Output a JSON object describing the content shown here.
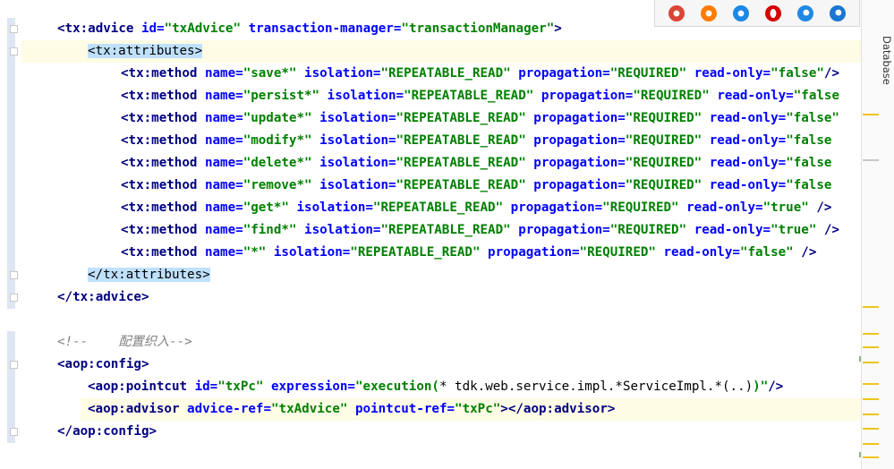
{
  "editor": {
    "lines": [
      {
        "parts": [
          [
            "tag",
            "<tx:advice "
          ],
          [
            "attr",
            "id="
          ],
          [
            "val",
            "\"txAdvice\""
          ],
          [
            "punct",
            " "
          ],
          [
            "attr",
            "transaction-manager="
          ],
          [
            "val",
            "\"transactionManager\""
          ],
          [
            "tag",
            ">"
          ]
        ]
      },
      {
        "parts": [
          [
            "tagbox",
            "<tx:attributes>"
          ]
        ]
      },
      {
        "parts": [
          [
            "tag",
            "<tx:method "
          ],
          [
            "attr",
            "name="
          ],
          [
            "val",
            "\"save*\""
          ],
          [
            "punct",
            " "
          ],
          [
            "attr",
            "isolation="
          ],
          [
            "val",
            "\"REPEATABLE_READ\""
          ],
          [
            "punct",
            " "
          ],
          [
            "attr",
            "propagation="
          ],
          [
            "val",
            "\"REQUIRED\""
          ],
          [
            "punct",
            " "
          ],
          [
            "attr",
            "read-only="
          ],
          [
            "val",
            "\"false\""
          ],
          [
            "tag",
            "/>"
          ]
        ]
      },
      {
        "parts": [
          [
            "tag",
            "<tx:method "
          ],
          [
            "attr",
            "name="
          ],
          [
            "val",
            "\"persist*\""
          ],
          [
            "punct",
            " "
          ],
          [
            "attr",
            "isolation="
          ],
          [
            "val",
            "\"REPEATABLE_READ\""
          ],
          [
            "punct",
            " "
          ],
          [
            "attr",
            "propagation="
          ],
          [
            "val",
            "\"REQUIRED\""
          ],
          [
            "punct",
            " "
          ],
          [
            "attr",
            "read-only="
          ],
          [
            "val",
            "\"false"
          ]
        ]
      },
      {
        "parts": [
          [
            "tag",
            "<tx:method "
          ],
          [
            "attr",
            "name="
          ],
          [
            "val",
            "\"update*\""
          ],
          [
            "punct",
            " "
          ],
          [
            "attr",
            "isolation="
          ],
          [
            "val",
            "\"REPEATABLE_READ\""
          ],
          [
            "punct",
            " "
          ],
          [
            "attr",
            "propagation="
          ],
          [
            "val",
            "\"REQUIRED\""
          ],
          [
            "punct",
            " "
          ],
          [
            "attr",
            "read-only="
          ],
          [
            "val",
            "\"false\""
          ]
        ]
      },
      {
        "parts": [
          [
            "tag",
            "<tx:method "
          ],
          [
            "attr",
            "name="
          ],
          [
            "val",
            "\"modify*\""
          ],
          [
            "punct",
            " "
          ],
          [
            "attr",
            "isolation="
          ],
          [
            "val",
            "\"REPEATABLE_READ\""
          ],
          [
            "punct",
            " "
          ],
          [
            "attr",
            "propagation="
          ],
          [
            "val",
            "\"REQUIRED\""
          ],
          [
            "punct",
            " "
          ],
          [
            "attr",
            "read-only="
          ],
          [
            "val",
            "\"false"
          ]
        ]
      },
      {
        "parts": [
          [
            "tag",
            "<tx:method "
          ],
          [
            "attr",
            "name="
          ],
          [
            "val",
            "\"delete*\""
          ],
          [
            "punct",
            " "
          ],
          [
            "attr",
            "isolation="
          ],
          [
            "val",
            "\"REPEATABLE_READ\""
          ],
          [
            "punct",
            " "
          ],
          [
            "attr",
            "propagation="
          ],
          [
            "val",
            "\"REQUIRED\""
          ],
          [
            "punct",
            " "
          ],
          [
            "attr",
            "read-only="
          ],
          [
            "val",
            "\"false"
          ]
        ]
      },
      {
        "parts": [
          [
            "tag",
            "<tx:method "
          ],
          [
            "attr",
            "name="
          ],
          [
            "val",
            "\"remove*\""
          ],
          [
            "punct",
            " "
          ],
          [
            "attr",
            "isolation="
          ],
          [
            "val",
            "\"REPEATABLE_READ\""
          ],
          [
            "punct",
            " "
          ],
          [
            "attr",
            "propagation="
          ],
          [
            "val",
            "\"REQUIRED\""
          ],
          [
            "punct",
            " "
          ],
          [
            "attr",
            "read-only="
          ],
          [
            "val",
            "\"false"
          ]
        ]
      },
      {
        "parts": [
          [
            "tag",
            "<tx:method "
          ],
          [
            "attr",
            "name="
          ],
          [
            "val",
            "\"get*\""
          ],
          [
            "punct",
            " "
          ],
          [
            "attr",
            "isolation="
          ],
          [
            "val",
            "\"REPEATABLE_READ\""
          ],
          [
            "punct",
            " "
          ],
          [
            "attr",
            "propagation="
          ],
          [
            "val",
            "\"REQUIRED\""
          ],
          [
            "punct",
            " "
          ],
          [
            "attr",
            "read-only="
          ],
          [
            "val",
            "\"true\""
          ],
          [
            "punct",
            " "
          ],
          [
            "tag",
            "/>"
          ]
        ]
      },
      {
        "parts": [
          [
            "tag",
            "<tx:method "
          ],
          [
            "attr",
            "name="
          ],
          [
            "val",
            "\"find*\""
          ],
          [
            "punct",
            " "
          ],
          [
            "attr",
            "isolation="
          ],
          [
            "val",
            "\"REPEATABLE_READ\""
          ],
          [
            "punct",
            " "
          ],
          [
            "attr",
            "propagation="
          ],
          [
            "val",
            "\"REQUIRED\""
          ],
          [
            "punct",
            " "
          ],
          [
            "attr",
            "read-only="
          ],
          [
            "val",
            "\"true\""
          ],
          [
            "punct",
            " "
          ],
          [
            "tag",
            "/>"
          ]
        ]
      },
      {
        "parts": [
          [
            "tag",
            "<tx:method "
          ],
          [
            "attr",
            "name="
          ],
          [
            "val",
            "\"*\""
          ],
          [
            "punct",
            " "
          ],
          [
            "attr",
            "isolation="
          ],
          [
            "val",
            "\"REPEATABLE_READ\""
          ],
          [
            "punct",
            " "
          ],
          [
            "attr",
            "propagation="
          ],
          [
            "val",
            "\"REQUIRED\""
          ],
          [
            "punct",
            " "
          ],
          [
            "attr",
            "read-only="
          ],
          [
            "val",
            "\"false\""
          ],
          [
            "punct",
            " "
          ],
          [
            "tag",
            "/>"
          ]
        ]
      },
      {
        "parts": [
          [
            "tagbox",
            "</tx:attributes>"
          ]
        ]
      },
      {
        "parts": [
          [
            "tag",
            "</tx:advice>"
          ]
        ]
      },
      {
        "parts": []
      },
      {
        "parts": [
          [
            "cmt",
            "<!--    配置织入-->"
          ]
        ]
      },
      {
        "parts": [
          [
            "tag",
            "<aop:config>"
          ]
        ]
      },
      {
        "parts": [
          [
            "tag",
            "<aop:pointcut "
          ],
          [
            "attr",
            "id="
          ],
          [
            "val",
            "\"txPc\""
          ],
          [
            "punct",
            " "
          ],
          [
            "attr",
            "expression="
          ],
          [
            "val",
            "\"execution("
          ],
          [
            "valgray",
            "* tdk.web.service.impl.*ServiceImpl.*(..)"
          ],
          [
            "val",
            ")\""
          ],
          [
            "tag",
            "/>"
          ]
        ]
      },
      {
        "parts": [
          [
            "tag",
            "<aop:advisor "
          ],
          [
            "attr",
            "advice-ref="
          ],
          [
            "val",
            "\"txAdvice\""
          ],
          [
            "punct",
            " "
          ],
          [
            "attr",
            "pointcut-ref="
          ],
          [
            "val",
            "\"txPc\""
          ],
          [
            "tag",
            "></aop:advisor>"
          ]
        ]
      },
      {
        "parts": [
          [
            "tag",
            "</aop:config>"
          ]
        ]
      }
    ]
  },
  "browsers": [
    {
      "name": "chrome-icon",
      "color": "#db4437"
    },
    {
      "name": "firefox-icon",
      "color": "#ff7b00"
    },
    {
      "name": "safari-icon",
      "color": "#1e88e5"
    },
    {
      "name": "opera-icon",
      "color": "#d50000"
    },
    {
      "name": "ie-icon",
      "color": "#1e88e5"
    },
    {
      "name": "edge-icon",
      "color": "#1976d2"
    }
  ],
  "right_panel": {
    "database_label": "Database"
  },
  "colors": {
    "tag": "#000080",
    "attr": "#0000ff",
    "val": "#008000",
    "comment": "#808080",
    "current_line": "#fefce5",
    "tag_highlight": "#bfe1fd"
  }
}
